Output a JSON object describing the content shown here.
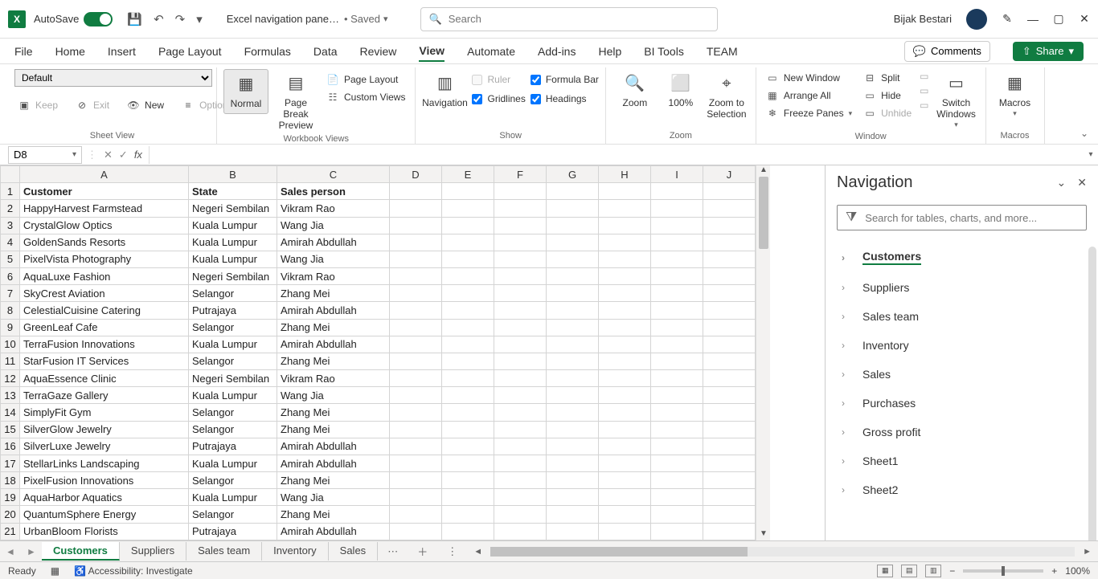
{
  "titlebar": {
    "autosave_label": "AutoSave",
    "filename": "Excel navigation pane…",
    "saved_label": "Saved",
    "search_placeholder": "Search",
    "user_name": "Bijak Bestari"
  },
  "ribbon_tabs": [
    "File",
    "Home",
    "Insert",
    "Page Layout",
    "Formulas",
    "Data",
    "Review",
    "View",
    "Automate",
    "Add-ins",
    "Help",
    "BI Tools",
    "TEAM"
  ],
  "ribbon_active_tab": "View",
  "comments_label": "Comments",
  "share_label": "Share",
  "ribbon": {
    "sheet_view": {
      "default": "Default",
      "keep": "Keep",
      "exit": "Exit",
      "new": "New",
      "options": "Options",
      "group_label": "Sheet View"
    },
    "workbook_views": {
      "normal": "Normal",
      "page_break": "Page Break Preview",
      "page_layout": "Page Layout",
      "custom_views": "Custom Views",
      "group_label": "Workbook Views"
    },
    "show": {
      "navigation": "Navigation",
      "ruler": "Ruler",
      "gridlines": "Gridlines",
      "formula_bar": "Formula Bar",
      "headings": "Headings",
      "group_label": "Show"
    },
    "zoom": {
      "zoom": "Zoom",
      "hundred": "100%",
      "zoom_selection": "Zoom to Selection",
      "group_label": "Zoom"
    },
    "window": {
      "new_window": "New Window",
      "arrange_all": "Arrange All",
      "freeze_panes": "Freeze Panes",
      "split": "Split",
      "hide": "Hide",
      "unhide": "Unhide",
      "switch_windows": "Switch Windows",
      "group_label": "Window"
    },
    "macros": {
      "macros": "Macros",
      "group_label": "Macros"
    }
  },
  "namebox": "D8",
  "columns": [
    "A",
    "B",
    "C",
    "D",
    "E",
    "F",
    "G",
    "H",
    "I",
    "J"
  ],
  "header_row": [
    "Customer",
    "State",
    "Sales person"
  ],
  "rows": [
    [
      "HappyHarvest Farmstead",
      "Negeri Sembilan",
      "Vikram Rao"
    ],
    [
      "CrystalGlow Optics",
      "Kuala Lumpur",
      "Wang Jia"
    ],
    [
      "GoldenSands Resorts",
      "Kuala Lumpur",
      "Amirah Abdullah"
    ],
    [
      "PixelVista Photography",
      "Kuala Lumpur",
      "Wang Jia"
    ],
    [
      "AquaLuxe Fashion",
      "Negeri Sembilan",
      "Vikram Rao"
    ],
    [
      "SkyCrest Aviation",
      "Selangor",
      "Zhang Mei"
    ],
    [
      "CelestialCuisine Catering",
      "Putrajaya",
      "Amirah Abdullah"
    ],
    [
      "GreenLeaf Cafe",
      "Selangor",
      "Zhang Mei"
    ],
    [
      "TerraFusion Innovations",
      "Kuala Lumpur",
      "Amirah Abdullah"
    ],
    [
      "StarFusion IT Services",
      "Selangor",
      "Zhang Mei"
    ],
    [
      "AquaEssence Clinic",
      "Negeri Sembilan",
      "Vikram Rao"
    ],
    [
      "TerraGaze Gallery",
      "Kuala Lumpur",
      "Wang Jia"
    ],
    [
      "SimplyFit Gym",
      "Selangor",
      "Zhang Mei"
    ],
    [
      "SilverGlow Jewelry",
      "Selangor",
      "Zhang Mei"
    ],
    [
      "SilverLuxe Jewelry",
      "Putrajaya",
      "Amirah Abdullah"
    ],
    [
      "StellarLinks Landscaping",
      "Kuala Lumpur",
      "Amirah Abdullah"
    ],
    [
      "PixelFusion Innovations",
      "Selangor",
      "Zhang Mei"
    ],
    [
      "AquaHarbor Aquatics",
      "Kuala Lumpur",
      "Wang Jia"
    ],
    [
      "QuantumSphere Energy",
      "Selangor",
      "Zhang Mei"
    ],
    [
      "UrbanBloom Florists",
      "Putrajaya",
      "Amirah Abdullah"
    ]
  ],
  "nav_pane": {
    "title": "Navigation",
    "search_placeholder": "Search for tables, charts, and more...",
    "items": [
      "Customers",
      "Suppliers",
      "Sales team",
      "Inventory",
      "Sales",
      "Purchases",
      "Gross profit",
      "Sheet1",
      "Sheet2"
    ],
    "active": "Customers"
  },
  "sheet_tabs": {
    "tabs": [
      "Customers",
      "Suppliers",
      "Sales team",
      "Inventory",
      "Sales"
    ],
    "active": "Customers"
  },
  "status": {
    "ready": "Ready",
    "accessibility": "Accessibility: Investigate",
    "zoom": "100%"
  }
}
